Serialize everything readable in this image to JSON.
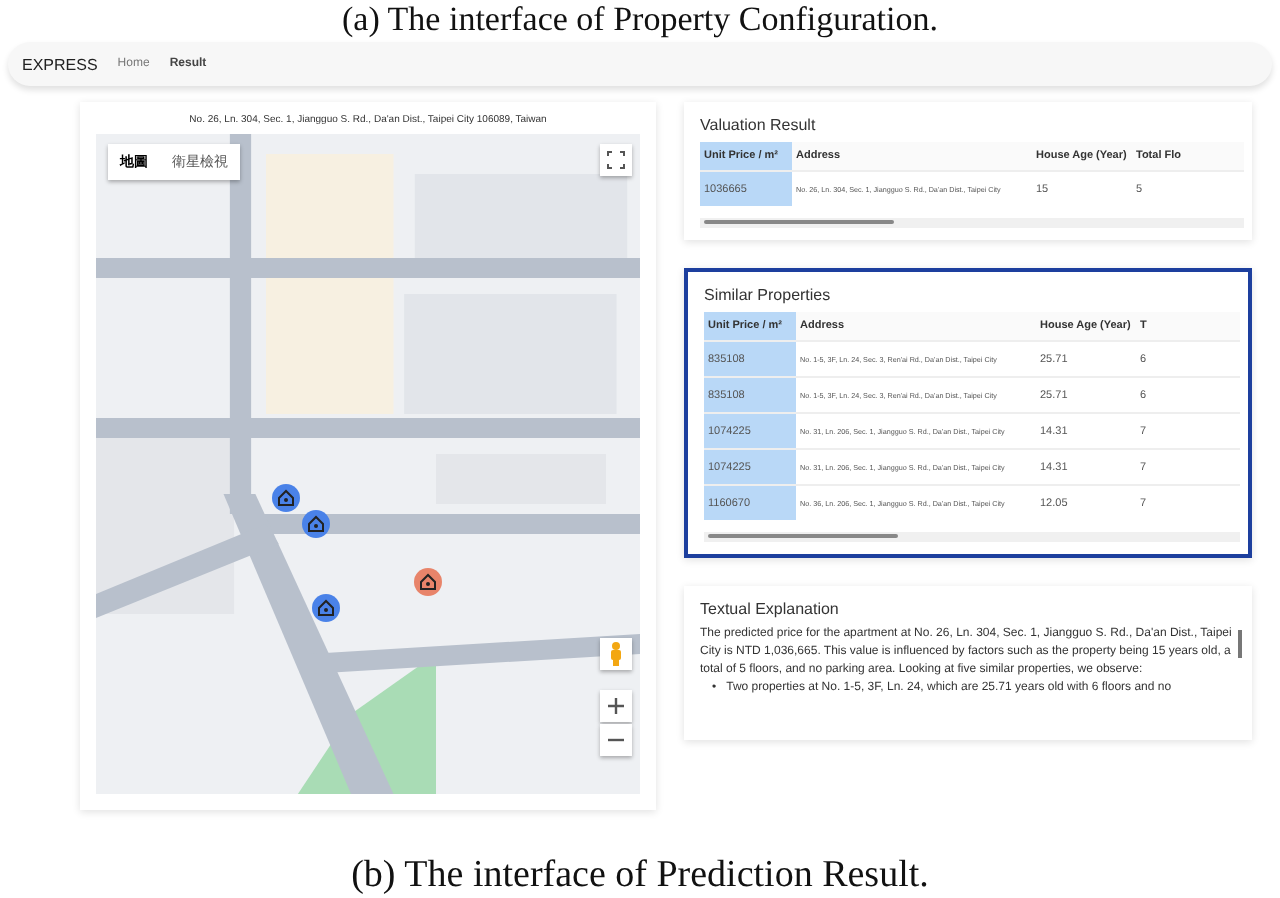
{
  "captions": [
    "(a) The interface of Property Configuration.",
    "(b) The interface of Prediction Result."
  ],
  "navbar": {
    "brand": "EXPRESS",
    "links": [
      {
        "label": "Home",
        "selected": false
      },
      {
        "label": "Result",
        "selected": true
      }
    ]
  },
  "map_panel": {
    "address": "No. 26, Ln. 304, Sec. 1, Jiangguo S. Rd., Da'an Dist., Taipei City 106089, Taiwan",
    "map_types": [
      {
        "label": "地圖",
        "selected": true
      },
      {
        "label": "衛星檢視",
        "selected": false
      }
    ],
    "markers": [
      {
        "kind": "similar"
      },
      {
        "kind": "similar"
      },
      {
        "kind": "similar"
      },
      {
        "kind": "target"
      }
    ]
  },
  "valuation": {
    "title": "Valuation Result",
    "columns": [
      "Unit Price / m²",
      "Address",
      "House Age (Year)",
      "Total Flo"
    ],
    "rows": [
      [
        "1036665",
        "No. 26, Ln. 304, Sec. 1, Jiangguo S. Rd., Da'an Dist., Taipei City",
        "15",
        "5"
      ]
    ]
  },
  "similar": {
    "title": "Similar Properties",
    "columns": [
      "Unit Price / m²",
      "Address",
      "House Age (Year)",
      "T"
    ],
    "rows": [
      [
        "835108",
        "No. 1-5, 3F, Ln. 24, Sec. 3, Ren'ai Rd., Da'an Dist., Taipei City",
        "25.71",
        "6"
      ],
      [
        "835108",
        "No. 1-5, 3F, Ln. 24, Sec. 3, Ren'ai Rd., Da'an Dist., Taipei City",
        "25.71",
        "6"
      ],
      [
        "1074225",
        "No. 31, Ln. 206, Sec. 1, Jiangguo S. Rd., Da'an Dist., Taipei City",
        "14.31",
        "7"
      ],
      [
        "1074225",
        "No. 31, Ln. 206, Sec. 1, Jiangguo S. Rd., Da'an Dist., Taipei City",
        "14.31",
        "7"
      ],
      [
        "1160670",
        "No. 36, Ln. 206, Sec. 1, Jiangguo S. Rd., Da'an Dist., Taipei City",
        "12.05",
        "7"
      ]
    ]
  },
  "explanation": {
    "title": "Textual Explanation",
    "paragraph": "The predicted price for the apartment at No. 26, Ln. 304, Sec. 1, Jiangguo S. Rd., Da'an Dist., Taipei City is NTD 1,036,665. This value is influenced by factors such as the property being 15 years old, a total of 5 floors, and no parking area. Looking at five similar properties, we observe:",
    "bullets": [
      {
        "marker": "•",
        "text": "Two properties at No. 1-5, 3F, Ln. 24, which are 25.71 years old with 6 floors and no"
      }
    ]
  }
}
